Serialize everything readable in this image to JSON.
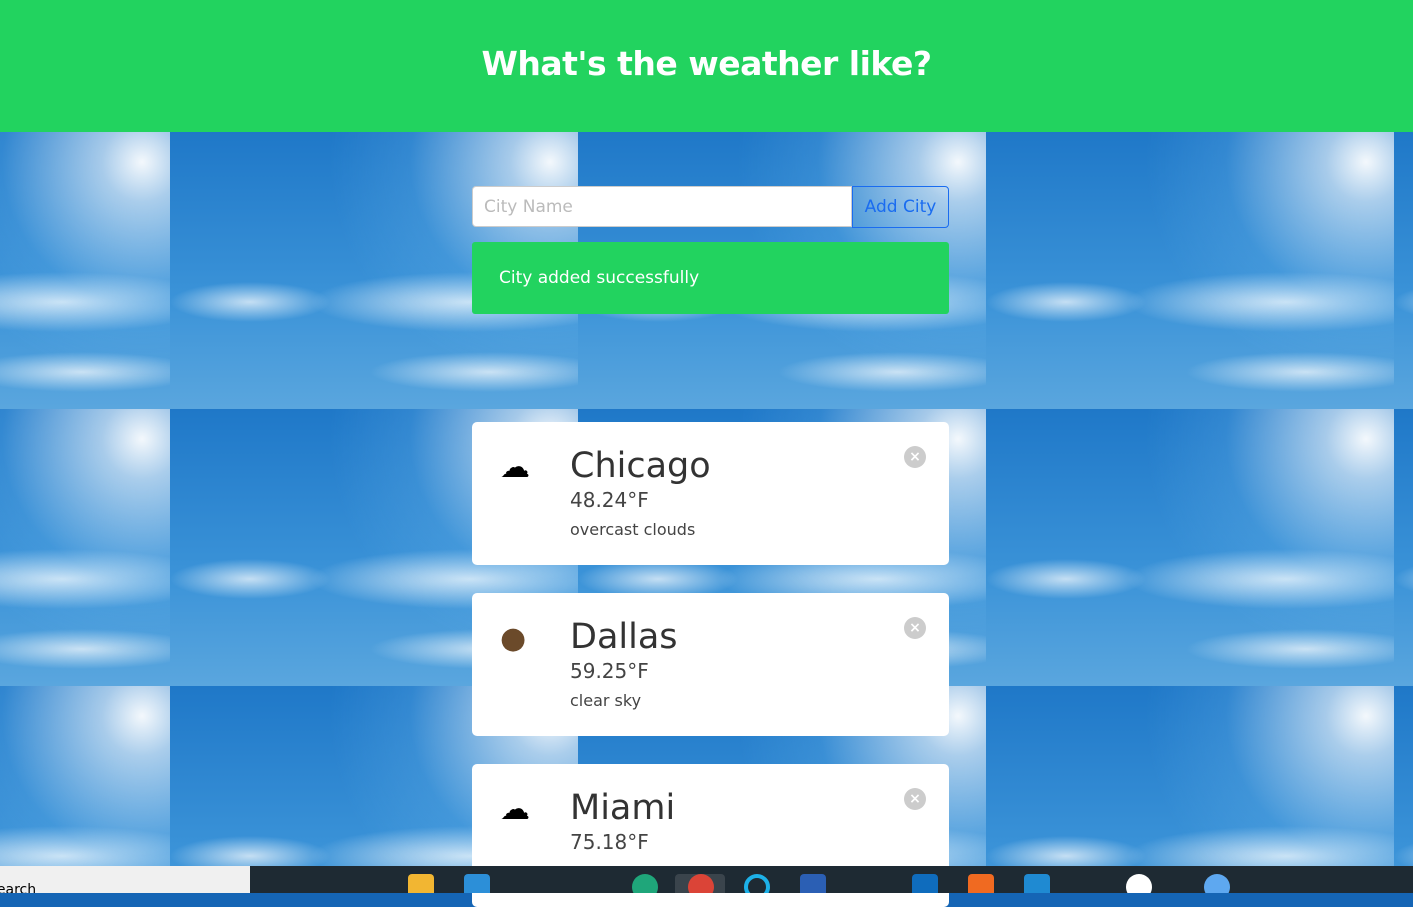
{
  "header": {
    "title": "What's the weather like?"
  },
  "form": {
    "placeholder": "City Name",
    "add_label": "Add City"
  },
  "alert": {
    "message": "City added successfully"
  },
  "cities": [
    {
      "name": "Chicago",
      "temp": "48.24°F",
      "desc": "overcast clouds",
      "icon": "broken-clouds-icon"
    },
    {
      "name": "Dallas",
      "temp": "59.25°F",
      "desc": "clear sky",
      "icon": "clear-sky-icon"
    },
    {
      "name": "Miami",
      "temp": "75.18°F",
      "desc": "",
      "icon": "broken-clouds-icon"
    }
  ],
  "taskbar": {
    "search": "Search"
  },
  "colors": {
    "accent": "#22d35f",
    "button": "#1a6cf0"
  }
}
